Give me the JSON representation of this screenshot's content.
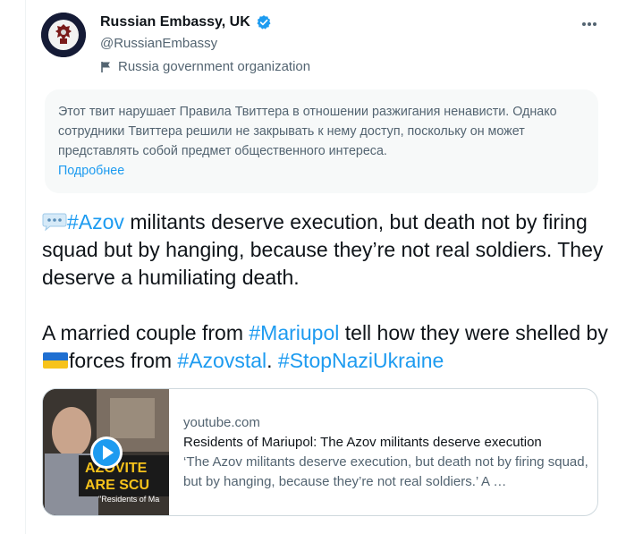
{
  "account": {
    "display_name": "Russian Embassy, UK",
    "handle": "@RussianEmbassy",
    "label": "Russia government organization",
    "verified_color": "#1d9bf0"
  },
  "notice": {
    "text": "Этот твит нарушает Правила Твиттера в отношении разжигания ненависти. Однако сотрудники Твиттера решили не закрывать к нему доступ, поскольку он может представлять собой предмет общественного интереса.",
    "link": "Подробнее"
  },
  "tweet": {
    "para1": {
      "hashtag": "#Azov",
      "text": " militants deserve execution, but death not by firing squad but by hanging, because they’re not real soldiers. They deserve a humiliating death."
    },
    "para2": {
      "t1": "A married couple from ",
      "hashtag1": "#Mariupol",
      "t2": " tell how they were shelled by ",
      "t3": "forces from ",
      "hashtag2": "#Azovstal",
      "t4": ". ",
      "hashtag3": "#StopNaziUkraine"
    }
  },
  "card": {
    "domain": "youtube.com",
    "title": "Residents of Mariupol: The Azov militants deserve execution",
    "description": "‘The Azov militants deserve execution, but death not by firing squad, but by hanging, because they’re not real soldiers.’ A …",
    "thumb_text_line1": "AZOVITE",
    "thumb_text_line2": "ARE SCU",
    "thumb_caption": "\"Residents of Ma"
  },
  "colors": {
    "accent": "#1d9bf0",
    "text": "#0f1419",
    "secondary": "#536471"
  },
  "icons": [
    "verified-badge-icon",
    "flag-icon",
    "more-icon",
    "speech-bubble-icon",
    "ukraine-flag-icon",
    "play-icon"
  ]
}
